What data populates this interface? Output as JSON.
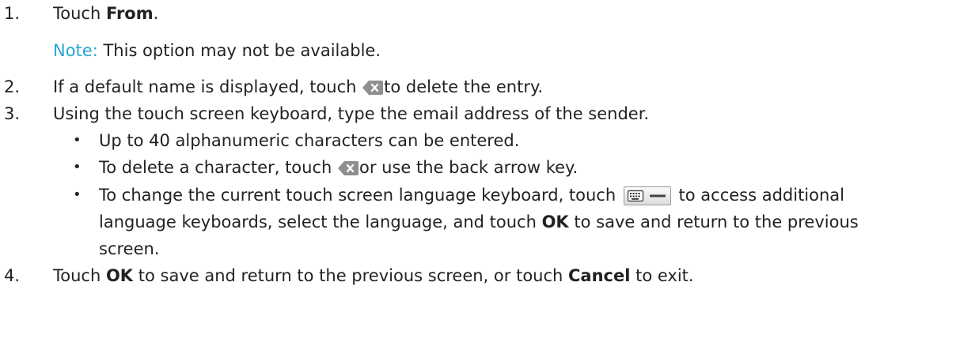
{
  "steps": [
    {
      "number": "1.",
      "pre": "Touch ",
      "bold": "From",
      "post": "."
    },
    {
      "number": "2.",
      "pre": "If a default name is displayed, touch ",
      "post": "to delete the entry."
    },
    {
      "number": "3.",
      "text": "Using the touch screen keyboard, type the email address of the sender."
    },
    {
      "number": "4.",
      "pre": "Touch ",
      "bold1": "OK",
      "mid": " to save and return to the previous screen, or touch ",
      "bold2": "Cancel",
      "post": " to exit."
    }
  ],
  "note": {
    "label": "Note:",
    "text": " This option may not be available."
  },
  "bullets": [
    {
      "glyph": "•",
      "text": "Up to 40 alphanumeric characters can be entered."
    },
    {
      "glyph": "•",
      "pre": "To delete a character, touch ",
      "post": "or use the back arrow key."
    },
    {
      "glyph": "•",
      "pre": "To change the current touch screen language keyboard, touch ",
      "post": " to access additional",
      "line2_pre": "language keyboards, select the language, and touch ",
      "line2_bold": "OK",
      "line2_post": " to save and return to the previous",
      "line3": "screen."
    }
  ],
  "icons": {
    "delete": "backspace-delete-icon",
    "keyboard": "keyboard-language-icon"
  }
}
